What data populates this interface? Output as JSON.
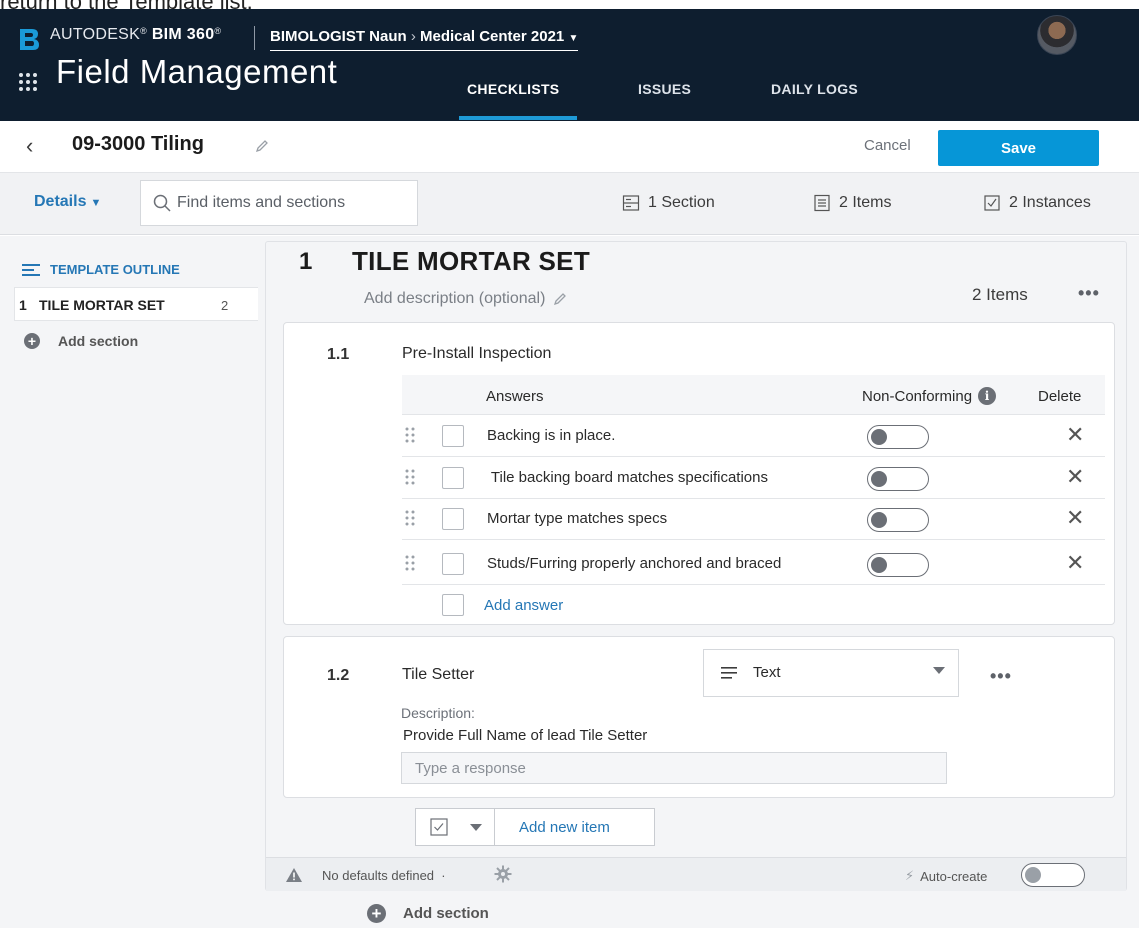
{
  "caption": "return to the Template list.",
  "header": {
    "brand_light": "AUTODESK",
    "brand_bold": "BIM 360",
    "account": "BIMOLOGIST Naun",
    "project": "Medical Center 2021",
    "app_title": "Field Management",
    "tabs": [
      {
        "label": "CHECKLISTS",
        "active": true
      },
      {
        "label": "ISSUES",
        "active": false
      },
      {
        "label": "DAILY LOGS",
        "active": false
      }
    ]
  },
  "titlebar": {
    "title": "09-3000 Tiling",
    "cancel_label": "Cancel",
    "save_label": "Save"
  },
  "toolbar": {
    "details_label": "Details",
    "search_placeholder": "Find items and sections",
    "sections_count": "1 Section",
    "items_count": "2 Items",
    "instances_count": "2 Instances"
  },
  "sidebar": {
    "outline_heading": "TEMPLATE OUTLINE",
    "items": [
      {
        "num": "1",
        "name": "TILE MORTAR SET",
        "count": "2"
      }
    ],
    "add_section_label": "Add section"
  },
  "section": {
    "number": "1",
    "title": "TILE MORTAR SET",
    "description_placeholder": "Add description (optional)",
    "items_count": "2 Items",
    "items": [
      {
        "number": "1.1",
        "title": "Pre-Install Inspection",
        "columns": {
          "answers": "Answers",
          "non_conforming": "Non-Conforming",
          "delete": "Delete"
        },
        "answers": [
          {
            "text": "Backing is in place.",
            "non_conforming": false
          },
          {
            "text": " Tile backing board matches specifications",
            "non_conforming": false
          },
          {
            "text": "Mortar type matches specs",
            "non_conforming": false
          },
          {
            "text": "Studs/Furring properly anchored and braced",
            "non_conforming": false
          }
        ],
        "add_answer_label": "Add answer"
      },
      {
        "number": "1.2",
        "title": "Tile Setter",
        "type_value": "Text",
        "description_label": "Description:",
        "description_text": "Provide Full Name of lead Tile Setter",
        "response_placeholder": "Type a response"
      }
    ],
    "add_item_label": "Add new item",
    "footer": {
      "defaults_text": "No defaults defined",
      "auto_create_label": "Auto-create",
      "auto_create_on": false
    }
  },
  "bottom_add_section_label": "Add section",
  "colors": {
    "topbar": "#0e1e2f",
    "accent": "#0696d7",
    "link": "#2577b5"
  }
}
